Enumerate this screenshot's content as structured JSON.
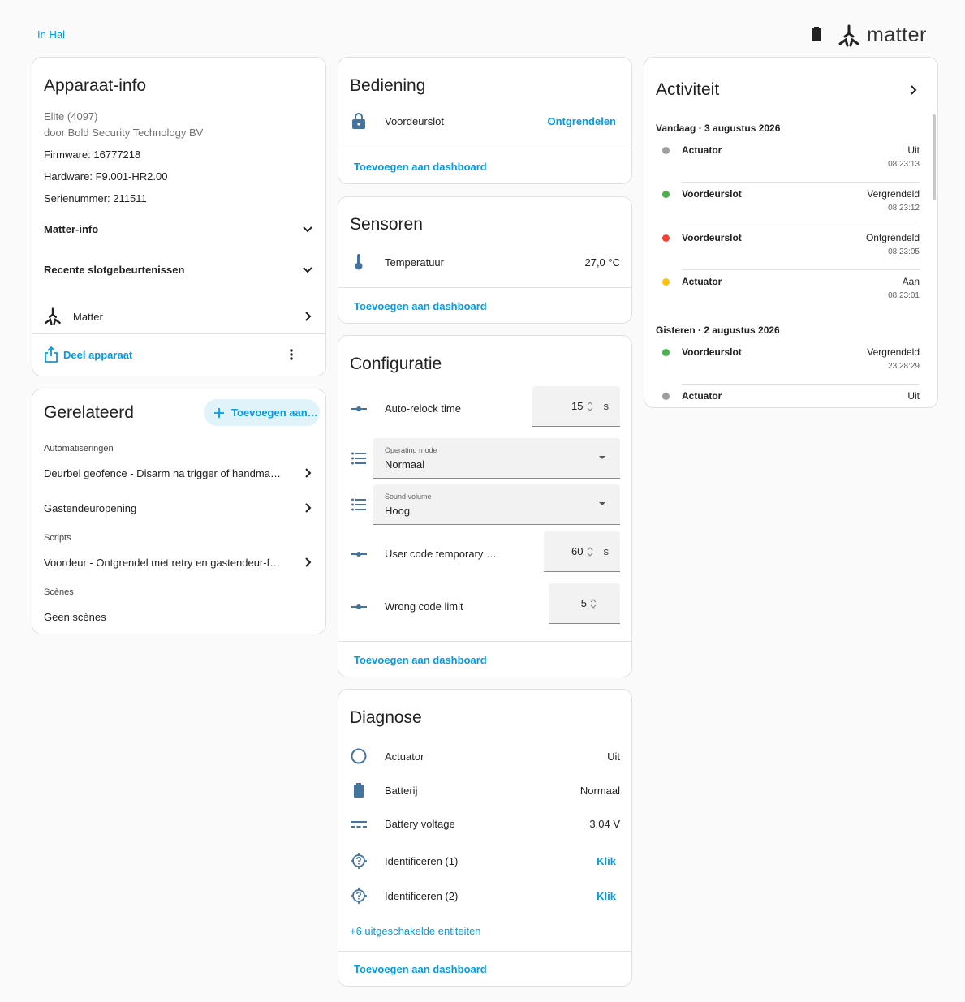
{
  "header": {
    "area": "In Hal",
    "brand": "matter"
  },
  "device_info": {
    "title": "Apparaat-info",
    "model": "Elite (4097)",
    "manufacturer": "door Bold Security Technology BV",
    "firmware": "Firmware: 16777218",
    "hardware": "Hardware: F9.001-HR2.00",
    "serial": "Serienummer: 211511",
    "matter_info": "Matter-info",
    "recent_events": "Recente slotgebeurtenissen",
    "integration": "Matter",
    "share": "Deel apparaat"
  },
  "related": {
    "title": "Gerelateerd",
    "add_button": "Toevoegen aan…",
    "automations_label": "Automatiseringen",
    "automations": [
      "Deurbel geofence - Disarm na trigger of handmatig …",
      "Gastendeuropening"
    ],
    "scripts_label": "Scripts",
    "scripts": [
      "Voordeur - Ontgrendel met retry en gastendeur-fallb…"
    ],
    "scenes_label": "Scènes",
    "scenes_empty": "Geen scènes"
  },
  "controls": {
    "title": "Bediening",
    "lock_name": "Voordeurslot",
    "lock_action": "Ontgrendelen",
    "add_dashboard": "Toevoegen aan dashboard"
  },
  "sensors": {
    "title": "Sensoren",
    "temp_name": "Temperatuur",
    "temp_value": "27,0 °C",
    "add_dashboard": "Toevoegen aan dashboard"
  },
  "config": {
    "title": "Configuratie",
    "autorelock_label": "Auto-relock time",
    "autorelock_value": "15",
    "autorelock_unit": "s",
    "opmode_label": "Operating mode",
    "opmode_value": "Normaal",
    "sound_label": "Sound volume",
    "sound_value": "Hoog",
    "usercode_label": "User code temporary …",
    "usercode_value": "60",
    "usercode_unit": "s",
    "wrongcode_label": "Wrong code limit",
    "wrongcode_value": "5",
    "add_dashboard": "Toevoegen aan dashboard"
  },
  "diagnostics": {
    "title": "Diagnose",
    "rows": [
      {
        "name": "Actuator",
        "value": "Uit"
      },
      {
        "name": "Batterij",
        "value": "Normaal"
      },
      {
        "name": "Battery voltage",
        "value": "3,04 V"
      },
      {
        "name": "Identificeren (1)",
        "value": "Klik"
      },
      {
        "name": "Identificeren (2)",
        "value": "Klik"
      }
    ],
    "disabled": "+6 uitgeschakelde entiteiten",
    "add_dashboard": "Toevoegen aan dashboard"
  },
  "activity": {
    "title": "Activiteit",
    "today": "Vandaag · 3 augustus 2026",
    "yesterday": "Gisteren · 2 augustus 2026",
    "entries": [
      {
        "name": "Actuator",
        "state": "Uit",
        "time": "08:23:13",
        "color": "#9e9e9e"
      },
      {
        "name": "Voordeurslot",
        "state": "Vergrendeld",
        "time": "08:23:12",
        "color": "#4caf50"
      },
      {
        "name": "Voordeurslot",
        "state": "Ontgrendeld",
        "time": "08:23:05",
        "color": "#f44336"
      },
      {
        "name": "Actuator",
        "state": "Aan",
        "time": "08:23:01",
        "color": "#ffc107"
      },
      {
        "name": "Voordeurslot",
        "state": "Vergrendeld",
        "time": "23:28:29",
        "color": "#4caf50"
      },
      {
        "name": "Actuator",
        "state": "Uit",
        "time": "",
        "color": "#9e9e9e"
      }
    ]
  },
  "colors": {
    "accent": "#039be5",
    "icon": "#44739e"
  }
}
